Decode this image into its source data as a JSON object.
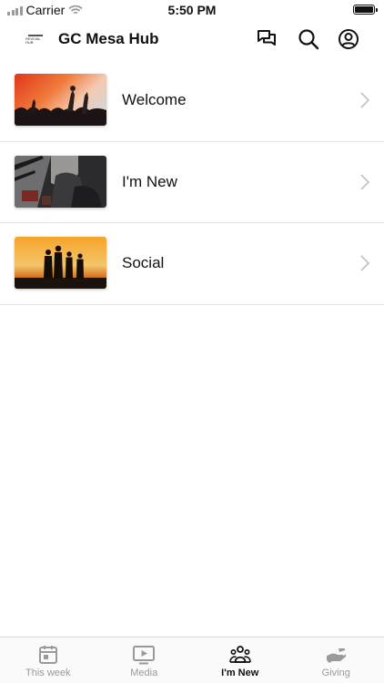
{
  "status_bar": {
    "carrier": "Carrier",
    "time": "5:50 PM"
  },
  "header": {
    "logo_text": "REVIVAL HUB",
    "title": "GC Mesa Hub",
    "icons": [
      "chat-icon",
      "search-icon",
      "profile-icon"
    ]
  },
  "list": {
    "items": [
      {
        "label": "Welcome",
        "thumbnail": "concert-crowd-image"
      },
      {
        "label": "I'm New",
        "thumbnail": "people-sitting-image"
      },
      {
        "label": "Social",
        "thumbnail": "sunset-silhouettes-image"
      }
    ]
  },
  "tab_bar": {
    "tabs": [
      {
        "label": "This week",
        "icon": "calendar-icon",
        "active": false
      },
      {
        "label": "Media",
        "icon": "play-video-icon",
        "active": false
      },
      {
        "label": "I'm New",
        "icon": "group-icon",
        "active": true
      },
      {
        "label": "Giving",
        "icon": "giving-hand-icon",
        "active": false
      }
    ]
  },
  "colors": {
    "active_tab": "#111111",
    "inactive_tab": "#9a9a9a",
    "divider": "#e2e2e2"
  }
}
